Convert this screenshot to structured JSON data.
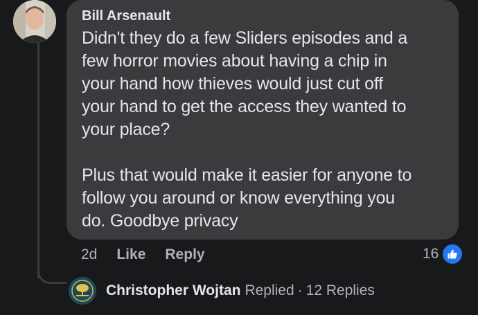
{
  "comment": {
    "author": "Bill Arsenault",
    "text": "Didn't they do a few Sliders episodes and a\nfew horror movies about having a chip in\nyour hand how thieves would just cut off\nyour hand to get the access they wanted to\nyour place?\n\nPlus that would make it easier for anyone to\nfollow you around or know everything you\ndo. Goodbye privacy",
    "time": "2d",
    "like_label": "Like",
    "reply_label": "Reply",
    "reaction_count": "16",
    "reaction_icon": "thumbs-up-icon"
  },
  "replies": {
    "author": "Christopher Wojtan",
    "replied_label": "Replied",
    "separator": "·",
    "count_label": "12 Replies"
  },
  "colors": {
    "background": "#18191a",
    "bubble": "#3a3b3c",
    "text": "#e4e6eb",
    "secondary_text": "#b0b3b8",
    "like_blue": "#2078f4"
  }
}
